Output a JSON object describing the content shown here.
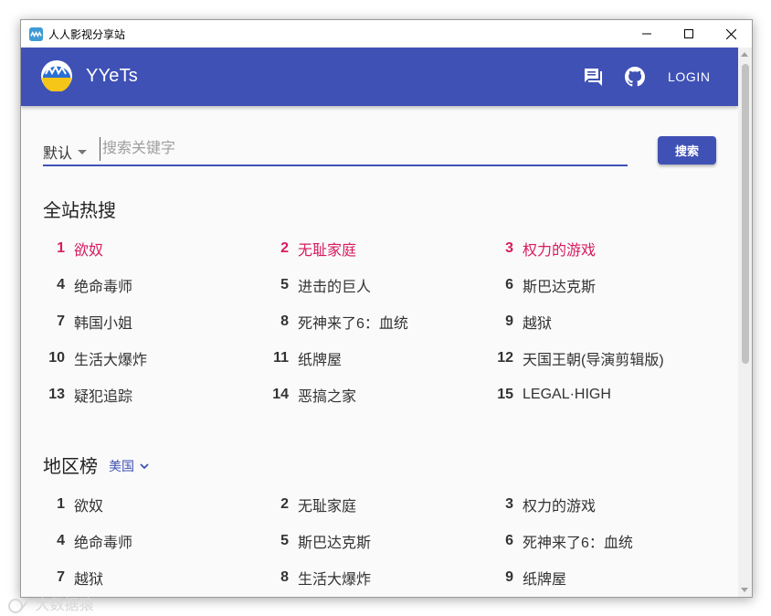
{
  "window": {
    "title": "人人影视分享站"
  },
  "appbar": {
    "brand": "YYeTs",
    "login_label": "LOGIN"
  },
  "search": {
    "mode": "默认",
    "placeholder": "搜索关键字",
    "button_label": "搜索"
  },
  "hot": {
    "title": "全站热搜",
    "items": [
      {
        "rank": "1",
        "name": "欲奴"
      },
      {
        "rank": "2",
        "name": "无耻家庭"
      },
      {
        "rank": "3",
        "name": "权力的游戏"
      },
      {
        "rank": "4",
        "name": "绝命毒师"
      },
      {
        "rank": "5",
        "name": "进击的巨人"
      },
      {
        "rank": "6",
        "name": "斯巴达克斯"
      },
      {
        "rank": "7",
        "name": "韩国小姐"
      },
      {
        "rank": "8",
        "name": "死神来了6：血统"
      },
      {
        "rank": "9",
        "name": "越狱"
      },
      {
        "rank": "10",
        "name": "生活大爆炸"
      },
      {
        "rank": "11",
        "name": "纸牌屋"
      },
      {
        "rank": "12",
        "name": "天国王朝(导演剪辑版)"
      },
      {
        "rank": "13",
        "name": "疑犯追踪"
      },
      {
        "rank": "14",
        "name": "恶搞之家"
      },
      {
        "rank": "15",
        "name": "LEGAL·HIGH"
      }
    ]
  },
  "region": {
    "title": "地区榜",
    "selected": "美国",
    "items": [
      {
        "rank": "1",
        "name": "欲奴"
      },
      {
        "rank": "2",
        "name": "无耻家庭"
      },
      {
        "rank": "3",
        "name": "权力的游戏"
      },
      {
        "rank": "4",
        "name": "绝命毒师"
      },
      {
        "rank": "5",
        "name": "斯巴达克斯"
      },
      {
        "rank": "6",
        "name": "死神来了6：血统"
      },
      {
        "rank": "7",
        "name": "越狱"
      },
      {
        "rank": "8",
        "name": "生活大爆炸"
      },
      {
        "rank": "9",
        "name": "纸牌屋"
      }
    ]
  },
  "watermark": "大数据猿",
  "colors": {
    "primary": "#3f51b5",
    "hot": "#d81b60"
  },
  "icons": [
    "app-icon",
    "minimize-icon",
    "maximize-icon",
    "close-icon",
    "feedback-icon",
    "github-icon",
    "chevron-down-icon"
  ]
}
